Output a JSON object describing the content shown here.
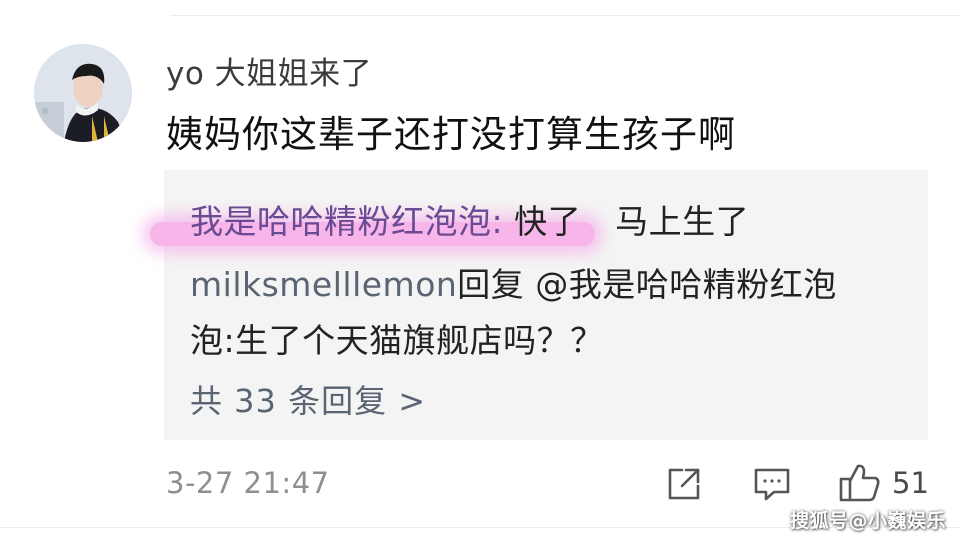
{
  "comment": {
    "username": "yo 大姐姐来了",
    "text": "姨妈你这辈子还打没打算生孩子啊",
    "timestamp": "3-27 21:47",
    "like_count": "51"
  },
  "replies": [
    {
      "author": "我是哈哈精粉红泡泡:",
      "text_part1": " 快了",
      "text_part2": "马上生了"
    },
    {
      "author": "milksmelllemon",
      "text": "回复 @我是哈哈精粉红泡"
    },
    {
      "text": "泡:生了个天猫旗舰店吗？？"
    }
  ],
  "more_replies_label": "共 33 条回复 >",
  "icons": {
    "share": "share-icon",
    "comment": "comment-icon",
    "like": "thumbs-up-icon",
    "avatar": "avatar"
  },
  "colors": {
    "highlight": "#f7b5ea",
    "reply_author": "#6a4a92",
    "link_gray": "#5a6472",
    "reply_bg": "#f4f4f4"
  },
  "watermark": "搜狐号@小巍娱乐"
}
